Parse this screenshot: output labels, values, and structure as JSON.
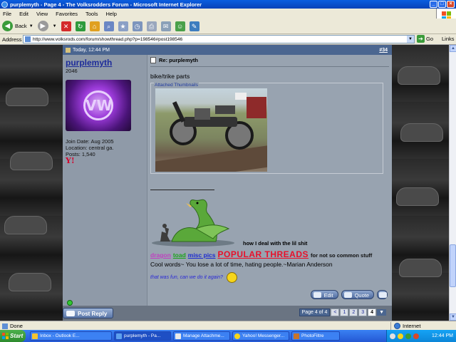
{
  "window": {
    "title": "purplemyth - Page 4 - The Volksrodders Forum - Microsoft Internet Explorer"
  },
  "menu": [
    "File",
    "Edit",
    "View",
    "Favorites",
    "Tools",
    "Help"
  ],
  "toolbar": {
    "back_label": "Back"
  },
  "address": {
    "label": "Address",
    "url": "http://www.volksrods.com/forum/showthread.php?p=198546#post198546",
    "go_label": "Go",
    "links_label": "Links"
  },
  "post": {
    "date": "Today, 12:44 PM",
    "number": "#34",
    "title": "Re: purplemyth",
    "body_text": "bike/trike parts",
    "attachments_label": "Attached Thumbnails",
    "user": {
      "name": "purplemyth",
      "title": "2046",
      "avatar_letters": "VW",
      "join_date": "Join Date: Aug 2005",
      "location": "Location: central ga.",
      "posts": "Posts: 1,540",
      "badge": "Y!"
    },
    "signature": {
      "dragon_caption": "how I deal with the lil shit",
      "links": [
        "dragon",
        "toad",
        "misc pics",
        "POPULAR THREADS"
      ],
      "links_suffix": "for not so common stuff",
      "quote": "Cool words~ You lose a lot of time, hating people.~Marian Anderson",
      "fun_line": "that was fun, can we do it again?"
    },
    "actions": {
      "edit": "Edit",
      "quote": "Quote"
    }
  },
  "footer": {
    "post_reply": "Post Reply",
    "pager_label": "Page 4 of 4",
    "prev": "<",
    "pages": [
      "1",
      "2",
      "3",
      "4"
    ],
    "current_page": "4",
    "menu_arrow": "▼"
  },
  "status": {
    "text": "Done",
    "zone": "Internet"
  },
  "taskbar": {
    "start": "Start",
    "tasks": [
      "Inbox - Outlook E...",
      "purplemyth - Pa...",
      "Manage Attachme...",
      "Yahoo! Messenger...",
      "PhotoFiltre"
    ],
    "active_task_index": 1,
    "clock": "12:44 PM"
  },
  "colors": {
    "header_bg": "#4b6690",
    "username": "#1d2b9a",
    "popular_threads": "#e8102a",
    "dragon_link": "#c040c0",
    "toad_link": "#1aa31a",
    "misc_link": "#1d2bd0"
  }
}
